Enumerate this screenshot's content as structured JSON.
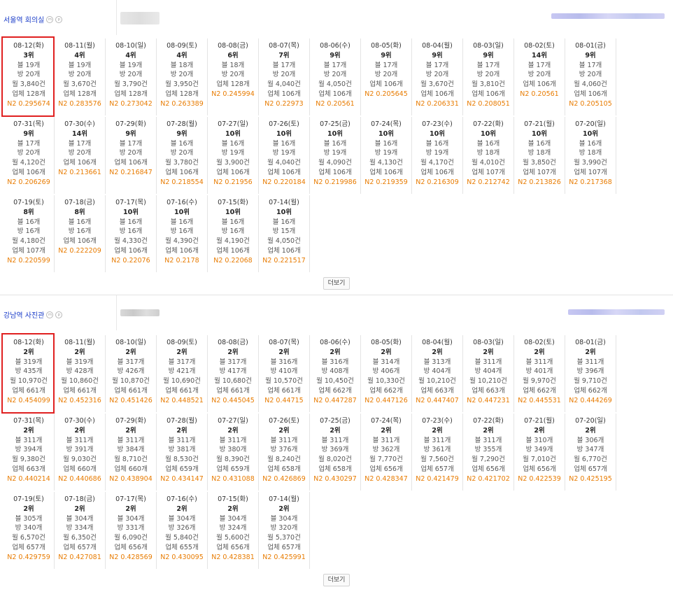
{
  "sections": [
    {
      "title": "서울역 회의실",
      "more_label": "더보기",
      "selected_index": 0,
      "entries": [
        {
          "date": "08-12(화)",
          "rank": "3위",
          "blog": "블 19개",
          "bang": "방 20개",
          "month": "월 3,840건",
          "biz": "업체 128개",
          "n2": "N2 0.295674"
        },
        {
          "date": "08-11(월)",
          "rank": "4위",
          "blog": "블 19개",
          "bang": "방 20개",
          "month": "월 3,670건",
          "biz": "업체 128개",
          "n2": "N2 0.283576"
        },
        {
          "date": "08-10(일)",
          "rank": "4위",
          "blog": "블 19개",
          "bang": "방 20개",
          "month": "월 3,790건",
          "biz": "업체 128개",
          "n2": "N2 0.273042"
        },
        {
          "date": "08-09(토)",
          "rank": "4위",
          "blog": "블 18개",
          "bang": "방 20개",
          "month": "월 3,950건",
          "biz": "업체 128개",
          "n2": "N2 0.263389"
        },
        {
          "date": "08-08(금)",
          "rank": "6위",
          "blog": "블 18개",
          "bang": "방 20개",
          "month": "업체 128개",
          "biz": "N2 0.245994",
          "n2": ""
        },
        {
          "date": "08-07(목)",
          "rank": "7위",
          "blog": "블 17개",
          "bang": "방 20개",
          "month": "월 4,040건",
          "biz": "업체 106개",
          "n2": "N2 0.22973"
        },
        {
          "date": "08-06(수)",
          "rank": "9위",
          "blog": "블 17개",
          "bang": "방 20개",
          "month": "월 4,050건",
          "biz": "업체 106개",
          "n2": "N2 0.20561"
        },
        {
          "date": "08-05(화)",
          "rank": "9위",
          "blog": "블 17개",
          "bang": "방 20개",
          "month": "업체 106개",
          "biz": "N2 0.205645",
          "n2": ""
        },
        {
          "date": "08-04(월)",
          "rank": "9위",
          "blog": "블 17개",
          "bang": "방 20개",
          "month": "월 3,670건",
          "biz": "업체 106개",
          "n2": "N2 0.206331"
        },
        {
          "date": "08-03(일)",
          "rank": "9위",
          "blog": "블 17개",
          "bang": "방 20개",
          "month": "월 3,810건",
          "biz": "업체 106개",
          "n2": "N2 0.208051"
        },
        {
          "date": "08-02(토)",
          "rank": "14위",
          "blog": "블 17개",
          "bang": "방 20개",
          "month": "업체 106개",
          "biz": "N2 0.20561",
          "n2": ""
        },
        {
          "date": "08-01(금)",
          "rank": "9위",
          "blog": "블 17개",
          "bang": "방 20개",
          "month": "월 4,060건",
          "biz": "업체 106개",
          "n2": "N2 0.205105"
        },
        {
          "date": "07-31(목)",
          "rank": "9위",
          "blog": "블 17개",
          "bang": "방 20개",
          "month": "월 4,120건",
          "biz": "업체 106개",
          "n2": "N2 0.206269"
        },
        {
          "date": "07-30(수)",
          "rank": "14위",
          "blog": "블 17개",
          "bang": "방 20개",
          "month": "업체 106개",
          "biz": "N2 0.213661",
          "n2": ""
        },
        {
          "date": "07-29(화)",
          "rank": "9위",
          "blog": "블 17개",
          "bang": "방 20개",
          "month": "업체 106개",
          "biz": "N2 0.216847",
          "n2": ""
        },
        {
          "date": "07-28(월)",
          "rank": "9위",
          "blog": "블 16개",
          "bang": "방 20개",
          "month": "월 3,780건",
          "biz": "업체 106개",
          "n2": "N2 0.218554"
        },
        {
          "date": "07-27(일)",
          "rank": "10위",
          "blog": "블 16개",
          "bang": "방 19개",
          "month": "월 3,900건",
          "biz": "업체 106개",
          "n2": "N2 0.21956"
        },
        {
          "date": "07-26(토)",
          "rank": "10위",
          "blog": "블 16개",
          "bang": "방 19개",
          "month": "월 4,040건",
          "biz": "업체 106개",
          "n2": "N2 0.220184"
        },
        {
          "date": "07-25(금)",
          "rank": "10위",
          "blog": "블 16개",
          "bang": "방 19개",
          "month": "월 4,090건",
          "biz": "업체 106개",
          "n2": "N2 0.219986"
        },
        {
          "date": "07-24(목)",
          "rank": "10위",
          "blog": "블 16개",
          "bang": "방 19개",
          "month": "월 4,130건",
          "biz": "업체 106개",
          "n2": "N2 0.219359"
        },
        {
          "date": "07-23(수)",
          "rank": "10위",
          "blog": "블 16개",
          "bang": "방 19개",
          "month": "월 4,170건",
          "biz": "업체 106개",
          "n2": "N2 0.216309"
        },
        {
          "date": "07-22(화)",
          "rank": "10위",
          "blog": "블 16개",
          "bang": "방 18개",
          "month": "월 4,010건",
          "biz": "업체 107개",
          "n2": "N2 0.212742"
        },
        {
          "date": "07-21(월)",
          "rank": "10위",
          "blog": "블 16개",
          "bang": "방 18개",
          "month": "월 3,850건",
          "biz": "업체 107개",
          "n2": "N2 0.213826"
        },
        {
          "date": "07-20(일)",
          "rank": "10위",
          "blog": "블 16개",
          "bang": "방 18개",
          "month": "월 3,990건",
          "biz": "업체 107개",
          "n2": "N2 0.217368"
        },
        {
          "date": "07-19(토)",
          "rank": "8위",
          "blog": "블 16개",
          "bang": "방 16개",
          "month": "월 4,180건",
          "biz": "업체 107개",
          "n2": "N2 0.220599"
        },
        {
          "date": "07-18(금)",
          "rank": "8위",
          "blog": "블 16개",
          "bang": "방 16개",
          "month": "업체 106개",
          "biz": "N2 0.222209",
          "n2": ""
        },
        {
          "date": "07-17(목)",
          "rank": "10위",
          "blog": "블 16개",
          "bang": "방 16개",
          "month": "월 4,330건",
          "biz": "업체 106개",
          "n2": "N2 0.22076"
        },
        {
          "date": "07-16(수)",
          "rank": "10위",
          "blog": "블 16개",
          "bang": "방 16개",
          "month": "월 4,390건",
          "biz": "업체 106개",
          "n2": "N2 0.2178"
        },
        {
          "date": "07-15(화)",
          "rank": "10위",
          "blog": "블 16개",
          "bang": "방 16개",
          "month": "월 4,190건",
          "biz": "업체 106개",
          "n2": "N2 0.22068"
        },
        {
          "date": "07-14(월)",
          "rank": "10위",
          "blog": "블 16개",
          "bang": "방 15개",
          "month": "월 4,050건",
          "biz": "업체 106개",
          "n2": "N2 0.221517"
        }
      ]
    },
    {
      "title": "강남역 사진관",
      "more_label": "더보기",
      "selected_index": 0,
      "entries": [
        {
          "date": "08-12(화)",
          "rank": "2위",
          "blog": "블 319개",
          "bang": "방 435개",
          "month": "월 10,970건",
          "biz": "업체 661개",
          "n2": "N2 0.454099"
        },
        {
          "date": "08-11(월)",
          "rank": "2위",
          "blog": "블 319개",
          "bang": "방 428개",
          "month": "월 10,860건",
          "biz": "업체 661개",
          "n2": "N2 0.452316"
        },
        {
          "date": "08-10(일)",
          "rank": "2위",
          "blog": "블 317개",
          "bang": "방 426개",
          "month": "월 10,870건",
          "biz": "업체 661개",
          "n2": "N2 0.451426"
        },
        {
          "date": "08-09(토)",
          "rank": "2위",
          "blog": "블 317개",
          "bang": "방 421개",
          "month": "월 10,690건",
          "biz": "업체 661개",
          "n2": "N2 0.448521"
        },
        {
          "date": "08-08(금)",
          "rank": "2위",
          "blog": "블 317개",
          "bang": "방 417개",
          "month": "월 10,680건",
          "biz": "업체 661개",
          "n2": "N2 0.445045"
        },
        {
          "date": "08-07(목)",
          "rank": "2위",
          "blog": "블 316개",
          "bang": "방 410개",
          "month": "월 10,570건",
          "biz": "업체 661개",
          "n2": "N2 0.44715"
        },
        {
          "date": "08-06(수)",
          "rank": "2위",
          "blog": "블 316개",
          "bang": "방 408개",
          "month": "월 10,450건",
          "biz": "업체 662개",
          "n2": "N2 0.447287"
        },
        {
          "date": "08-05(화)",
          "rank": "2위",
          "blog": "블 314개",
          "bang": "방 406개",
          "month": "월 10,330건",
          "biz": "업체 662개",
          "n2": "N2 0.447126"
        },
        {
          "date": "08-04(월)",
          "rank": "2위",
          "blog": "블 313개",
          "bang": "방 404개",
          "month": "월 10,210건",
          "biz": "업체 663개",
          "n2": "N2 0.447407"
        },
        {
          "date": "08-03(일)",
          "rank": "2위",
          "blog": "블 311개",
          "bang": "방 404개",
          "month": "월 10,210건",
          "biz": "업체 663개",
          "n2": "N2 0.447231"
        },
        {
          "date": "08-02(토)",
          "rank": "2위",
          "blog": "블 311개",
          "bang": "방 401개",
          "month": "월 9,970건",
          "biz": "업체 662개",
          "n2": "N2 0.445531"
        },
        {
          "date": "08-01(금)",
          "rank": "2위",
          "blog": "블 311개",
          "bang": "방 396개",
          "month": "월 9,710건",
          "biz": "업체 662개",
          "n2": "N2 0.444269"
        },
        {
          "date": "07-31(목)",
          "rank": "2위",
          "blog": "블 311개",
          "bang": "방 394개",
          "month": "월 9,380건",
          "biz": "업체 663개",
          "n2": "N2 0.440214"
        },
        {
          "date": "07-30(수)",
          "rank": "2위",
          "blog": "블 311개",
          "bang": "방 391개",
          "month": "월 9,030건",
          "biz": "업체 660개",
          "n2": "N2 0.440686"
        },
        {
          "date": "07-29(화)",
          "rank": "2위",
          "blog": "블 311개",
          "bang": "방 384개",
          "month": "월 8,710건",
          "biz": "업체 660개",
          "n2": "N2 0.438904"
        },
        {
          "date": "07-28(월)",
          "rank": "2위",
          "blog": "블 311개",
          "bang": "방 381개",
          "month": "월 8,530건",
          "biz": "업체 659개",
          "n2": "N2 0.434147"
        },
        {
          "date": "07-27(일)",
          "rank": "2위",
          "blog": "블 311개",
          "bang": "방 380개",
          "month": "월 8,390건",
          "biz": "업체 659개",
          "n2": "N2 0.431088"
        },
        {
          "date": "07-26(토)",
          "rank": "2위",
          "blog": "블 311개",
          "bang": "방 376개",
          "month": "월 8,240건",
          "biz": "업체 658개",
          "n2": "N2 0.426869"
        },
        {
          "date": "07-25(금)",
          "rank": "2위",
          "blog": "블 311개",
          "bang": "방 369개",
          "month": "월 8,020건",
          "biz": "업체 658개",
          "n2": "N2 0.430297"
        },
        {
          "date": "07-24(목)",
          "rank": "2위",
          "blog": "블 311개",
          "bang": "방 362개",
          "month": "월 7,770건",
          "biz": "업체 656개",
          "n2": "N2 0.428347"
        },
        {
          "date": "07-23(수)",
          "rank": "2위",
          "blog": "블 311개",
          "bang": "방 361개",
          "month": "월 7,560건",
          "biz": "업체 657개",
          "n2": "N2 0.421479"
        },
        {
          "date": "07-22(화)",
          "rank": "2위",
          "blog": "블 311개",
          "bang": "방 355개",
          "month": "월 7,290건",
          "biz": "업체 656개",
          "n2": "N2 0.421702"
        },
        {
          "date": "07-21(월)",
          "rank": "2위",
          "blog": "블 310개",
          "bang": "방 349개",
          "month": "월 7,010건",
          "biz": "업체 656개",
          "n2": "N2 0.422539"
        },
        {
          "date": "07-20(일)",
          "rank": "2위",
          "blog": "블 306개",
          "bang": "방 347개",
          "month": "월 6,770건",
          "biz": "업체 657개",
          "n2": "N2 0.425195"
        },
        {
          "date": "07-19(토)",
          "rank": "2위",
          "blog": "블 305개",
          "bang": "방 340개",
          "month": "월 6,570건",
          "biz": "업체 657개",
          "n2": "N2 0.429759"
        },
        {
          "date": "07-18(금)",
          "rank": "2위",
          "blog": "블 304개",
          "bang": "방 334개",
          "month": "월 6,350건",
          "biz": "업체 657개",
          "n2": "N2 0.427081"
        },
        {
          "date": "07-17(목)",
          "rank": "2위",
          "blog": "블 304개",
          "bang": "방 331개",
          "month": "월 6,090건",
          "biz": "업체 656개",
          "n2": "N2 0.428569"
        },
        {
          "date": "07-16(수)",
          "rank": "2위",
          "blog": "블 304개",
          "bang": "방 326개",
          "month": "월 5,840건",
          "biz": "업체 655개",
          "n2": "N2 0.430095"
        },
        {
          "date": "07-15(화)",
          "rank": "2위",
          "blog": "블 304개",
          "bang": "방 324개",
          "month": "월 5,600건",
          "biz": "업체 656개",
          "n2": "N2 0.428381"
        },
        {
          "date": "07-14(월)",
          "rank": "2위",
          "blog": "블 304개",
          "bang": "방 320개",
          "month": "월 5,370건",
          "biz": "업체 657개",
          "n2": "N2 0.425991"
        }
      ]
    }
  ]
}
